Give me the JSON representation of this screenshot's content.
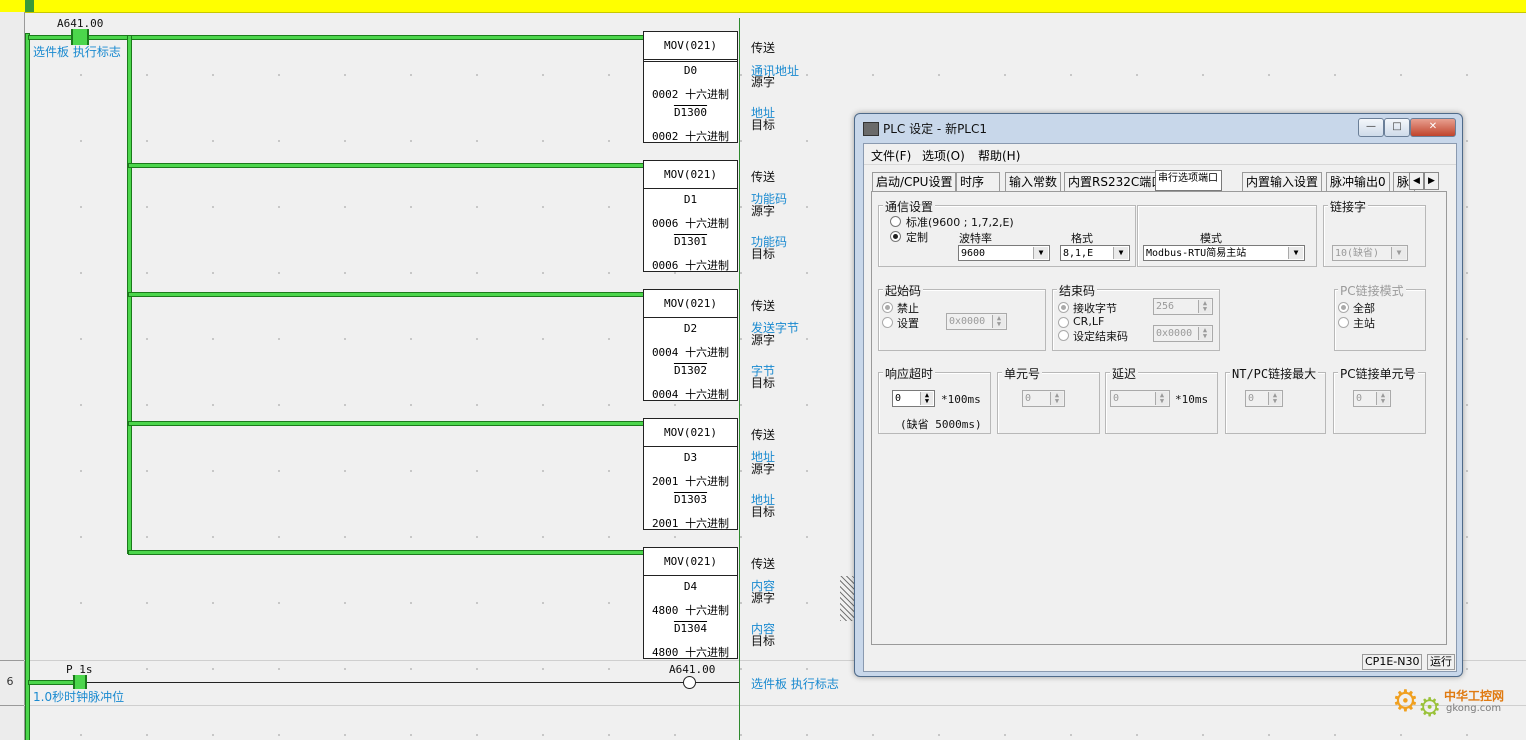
{
  "ladder": {
    "contact_top": {
      "address": "A641.00",
      "comment": "选件板 执行标志"
    },
    "blocks": [
      {
        "name": "MOV(021)",
        "src": "D0",
        "src_val": "0002",
        "fmt": "十六进制",
        "dst": "D1300",
        "dst_val": "0002",
        "label": "传送",
        "src_comment": "通讯地址",
        "src_type": "源字",
        "dst_comment": "地址",
        "dst_type": "目标"
      },
      {
        "name": "MOV(021)",
        "src": "D1",
        "src_val": "0006",
        "fmt": "十六进制",
        "dst": "D1301",
        "dst_val": "0006",
        "label": "传送",
        "src_comment": "功能码",
        "src_type": "源字",
        "dst_comment": "功能码",
        "dst_type": "目标"
      },
      {
        "name": "MOV(021)",
        "src": "D2",
        "src_val": "0004",
        "fmt": "十六进制",
        "dst": "D1302",
        "dst_val": "0004",
        "label": "传送",
        "src_comment": "发送字节",
        "src_type": "源字",
        "dst_comment": "字节",
        "dst_type": "目标"
      },
      {
        "name": "MOV(021)",
        "src": "D3",
        "src_val": "2001",
        "fmt": "十六进制",
        "dst": "D1303",
        "dst_val": "2001",
        "label": "传送",
        "src_comment": "地址",
        "src_type": "源字",
        "dst_comment": "地址",
        "dst_type": "目标"
      },
      {
        "name": "MOV(021)",
        "src": "D4",
        "src_val": "4800",
        "fmt": "十六进制",
        "dst": "D1304",
        "dst_val": "4800",
        "label": "传送",
        "src_comment": "内容",
        "src_type": "源字",
        "dst_comment": "内容",
        "dst_type": "目标"
      }
    ],
    "rung6": {
      "number": "6",
      "contact": "P_1s",
      "contact_comment": "1.0秒时钟脉冲位",
      "coil": "A641.00",
      "coil_comment": "选件板 执行标志"
    }
  },
  "dialog": {
    "title": "PLC 设定 - 新PLC1",
    "window_buttons": [
      "—",
      "□",
      "✕"
    ],
    "menu": [
      "文件(F)",
      "选项(O)",
      "帮助(H)"
    ],
    "tabs": [
      "启动/CPU设置",
      "时序",
      "输入常数",
      "内置RS232C端口",
      "串行选项端口",
      "内置输入设置",
      "脉冲输出0",
      "脉"
    ],
    "selected_tab": "串行选项端口",
    "comm": {
      "title": "通信设置",
      "standard": "标准(9600 ; 1,7,2,E)",
      "custom": "定制",
      "baud_label": "波特率",
      "baud": "9600",
      "format_label": "格式",
      "format": "8,1,E",
      "mode_label": "模式",
      "mode": "Modbus-RTU简易主站"
    },
    "link_word": {
      "title": "链接字",
      "value": "10(缺省)"
    },
    "start_code": {
      "title": "起始码",
      "disable": "禁止",
      "set": "设置",
      "value": "0x0000"
    },
    "end_code": {
      "title": "结束码",
      "recv_bytes": "接收字节",
      "recv_val": "256",
      "crlf": "CR,LF",
      "set_end": "设定结束码",
      "end_val": "0x0000"
    },
    "pc_link_mode": {
      "title": "PC链接模式",
      "all": "全部",
      "master": "主站"
    },
    "response_timeout": {
      "title": "响应超时",
      "value": "0",
      "unit": "*100ms",
      "default": "(缺省 5000ms)"
    },
    "unit_no": {
      "title": "单元号",
      "value": "0"
    },
    "delay": {
      "title": "延迟",
      "value": "0",
      "unit": "*10ms"
    },
    "nt_pc_max": {
      "title": "NT/PC链接最大",
      "value": "0"
    },
    "pc_link_unit": {
      "title": "PC链接单元号",
      "value": "0"
    },
    "status": {
      "model": "CP1E-N30",
      "state": "运行"
    }
  },
  "watermark": {
    "cn": "中华工控网",
    "url": "gkong.com"
  },
  "colors": {
    "rail": "#4cd64c",
    "comment": "#1a8ad0",
    "topbar": "#ffff00"
  }
}
